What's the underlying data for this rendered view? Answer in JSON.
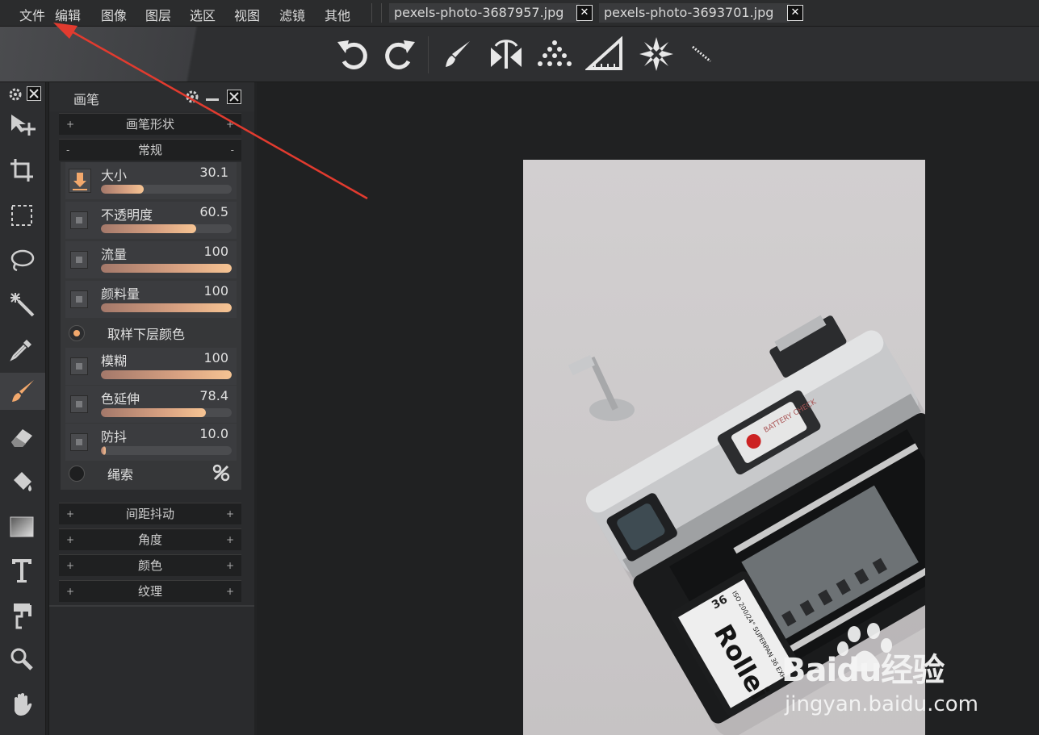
{
  "menu": [
    "文件",
    "编辑",
    "图像",
    "图层",
    "选区",
    "视图",
    "滤镜",
    "其他"
  ],
  "tabs": [
    {
      "label": "pexels-photo-3687957.jpg",
      "close": "✕"
    },
    {
      "label": "pexels-photo-3693701.jpg",
      "close": "✕"
    }
  ],
  "toolbar": [
    "undo-icon",
    "redo-icon",
    "brush-icon",
    "symmetry-icon",
    "scatter-icon",
    "ruler-icon",
    "kaleidoscope-icon",
    "line-icon"
  ],
  "tools": [
    "move-icon",
    "crop-icon",
    "marquee-icon",
    "lasso-icon",
    "magic-wand-icon",
    "eyedropper-icon",
    "brush-icon",
    "eraser-icon",
    "paint-bucket-icon",
    "gradient-icon",
    "text-icon",
    "smudge-icon",
    "zoom-icon",
    "hand-icon"
  ],
  "panel": {
    "title": "画笔",
    "sections_top": [
      {
        "label": "画笔形状",
        "toggle": "+"
      },
      {
        "label": "常规",
        "toggle": "-"
      }
    ],
    "sliders": [
      {
        "label": "大小",
        "value": "30.1",
        "fraction": 0.33
      },
      {
        "label": "不透明度",
        "value": "60.5",
        "fraction": 0.73
      },
      {
        "label": "流量",
        "value": "100",
        "fraction": 1.0
      },
      {
        "label": "颜料量",
        "value": "100",
        "fraction": 1.0
      }
    ],
    "sample_option": "取样下层颜色",
    "sliders2": [
      {
        "label": "模糊",
        "value": "100",
        "fraction": 1.0
      },
      {
        "label": "色延伸",
        "value": "78.4",
        "fraction": 0.8
      },
      {
        "label": "防抖",
        "value": "10.0",
        "fraction": 0.04
      }
    ],
    "lasso_option": "绳索",
    "sections_bottom": [
      {
        "label": "间距抖动",
        "toggle": "+"
      },
      {
        "label": "角度",
        "toggle": "+"
      },
      {
        "label": "颜色",
        "toggle": "+"
      },
      {
        "label": "纹理",
        "toggle": "+"
      }
    ]
  },
  "photo_text": {
    "brand": "Rollei",
    "film": "ISO 200/24° SUPERPAN 36 EXP",
    "count": "36",
    "battery": "BATTERY CHECK"
  },
  "watermark": {
    "logo": "Baidu经验",
    "url": "jingyan.baidu.com"
  },
  "colors": {
    "accent": "#f2a86c",
    "arrow": "#e23b2f"
  }
}
